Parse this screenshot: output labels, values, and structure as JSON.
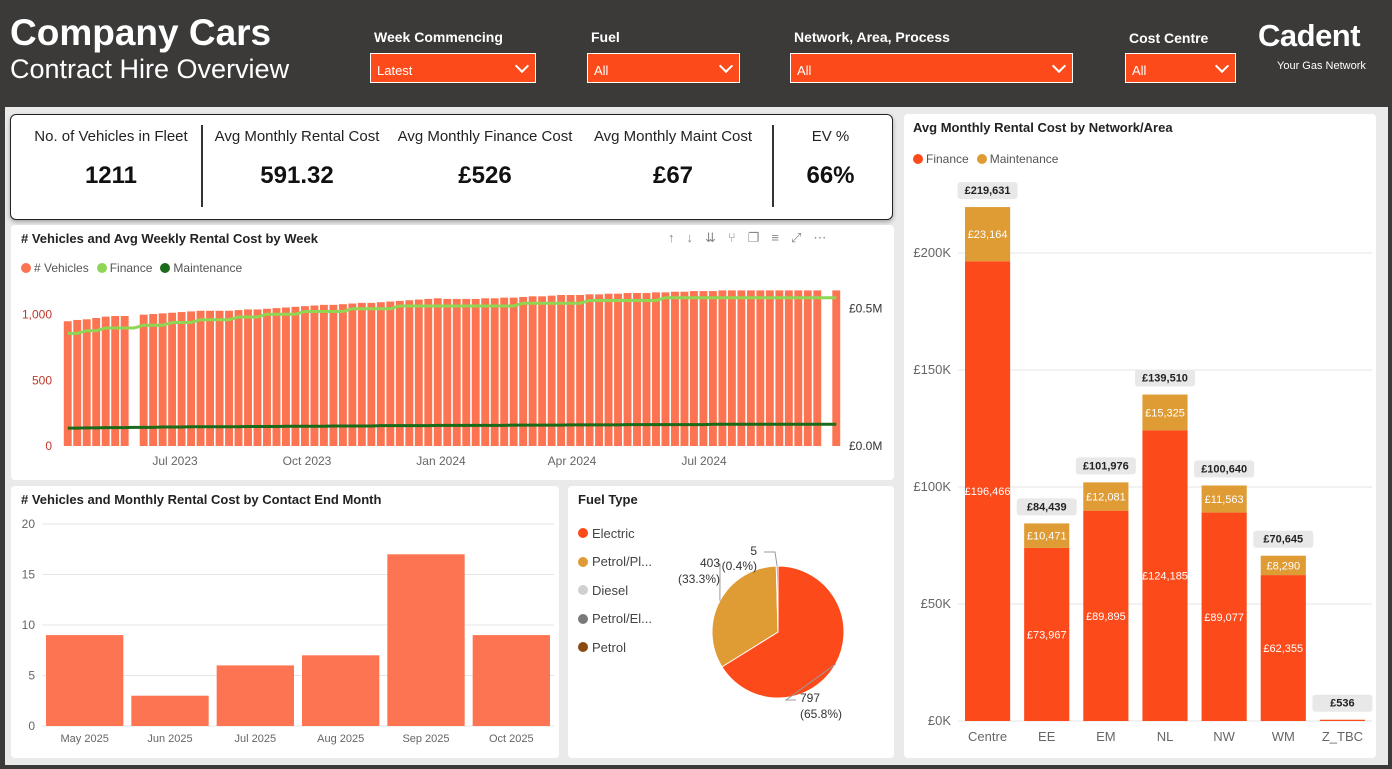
{
  "header": {
    "title": "Company Cars",
    "subtitle": "Contract Hire Overview",
    "filters": [
      {
        "label": "Week Commencing",
        "value": "Latest"
      },
      {
        "label": "Fuel",
        "value": "All"
      },
      {
        "label": "Network, Area, Process",
        "value": "All"
      },
      {
        "label": "Cost Centre",
        "value": "All"
      }
    ],
    "logo": "Cadent",
    "logo_tagline": "Your Gas Network"
  },
  "kpis": [
    {
      "label": "No. of Vehicles in Fleet",
      "value": "1211"
    },
    {
      "label": "Avg Monthly Rental Cost",
      "value": "591.32"
    },
    {
      "label": "Avg Monthly Finance Cost",
      "value": "£526"
    },
    {
      "label": "Avg Monthly Maint Cost",
      "value": "£67"
    },
    {
      "label": "EV %",
      "value": "66%"
    }
  ],
  "toolbar_icons": [
    "arrow-up-icon",
    "arrow-down-icon",
    "expand-all-icon",
    "drill-icon",
    "copy-icon",
    "filter-icon",
    "focus-icon",
    "more-icon"
  ],
  "colors": {
    "bar": "#fc7451",
    "finance": "#fc4a1a",
    "maintenance": "#df9b34",
    "green_light": "#8ed654",
    "green_dark": "#1a6b1a",
    "header": "#3b3a39"
  },
  "chart_data": [
    {
      "type": "bar",
      "title": "# Vehicles and Avg Weekly Rental Cost by Week",
      "legend": [
        "# Vehicles",
        "Finance",
        "Maintenance"
      ],
      "legend_position": "top-left",
      "x_ticks": [
        "Jul 2023",
        "Oct 2023",
        "Jan 2024",
        "Apr 2024",
        "Jul 2024"
      ],
      "y_ticks_left": [
        "0",
        "500",
        "1,000"
      ],
      "y_ticks_right": [
        "£0.0M",
        "£0.5M"
      ],
      "ylim_left": [
        0,
        1150
      ],
      "ylim_right": [
        0,
        0.55
      ],
      "series": [
        {
          "name": "# Vehicles",
          "values": [
            950,
            960,
            965,
            975,
            985,
            990,
            990,
            0,
            1000,
            1005,
            1010,
            1015,
            1020,
            1025,
            1030,
            1030,
            1030,
            1030,
            1035,
            1040,
            1040,
            1045,
            1050,
            1055,
            1060,
            1065,
            1070,
            1075,
            1075,
            1080,
            1085,
            1090,
            1090,
            1095,
            1100,
            1105,
            1110,
            1115,
            1120,
            1125,
            1120,
            1120,
            1120,
            1120,
            1125,
            1125,
            1130,
            1130,
            1135,
            1140,
            1140,
            1145,
            1150,
            1150,
            1150,
            1155,
            1155,
            1160,
            1160,
            1165,
            1165,
            1165,
            1170,
            1170,
            1175,
            1175,
            1180,
            1180,
            1180,
            1185,
            1185,
            1185,
            1185,
            1185,
            1185,
            1185,
            1185,
            1185,
            1185,
            1185,
            0,
            1185
          ]
        },
        {
          "name": "Finance",
          "values": [
            0.41,
            0.41,
            0.42,
            0.42,
            0.43,
            0.43,
            0.43,
            0.43,
            0.44,
            0.44,
            0.44,
            0.45,
            0.45,
            0.45,
            0.46,
            0.46,
            0.46,
            0.46,
            0.47,
            0.47,
            0.47,
            0.48,
            0.48,
            0.48,
            0.48,
            0.49,
            0.49,
            0.49,
            0.49,
            0.49,
            0.5,
            0.5,
            0.5,
            0.5,
            0.5,
            0.51,
            0.51,
            0.51,
            0.51,
            0.51,
            0.51,
            0.51,
            0.51,
            0.51,
            0.51,
            0.51,
            0.51,
            0.51,
            0.52,
            0.52,
            0.52,
            0.52,
            0.52,
            0.52,
            0.52,
            0.53,
            0.53,
            0.53,
            0.53,
            0.53,
            0.53,
            0.53,
            0.53,
            0.54,
            0.54,
            0.54,
            0.54,
            0.54,
            0.54,
            0.54,
            0.54,
            0.54,
            0.54,
            0.54,
            0.54,
            0.54,
            0.54,
            0.54,
            0.54,
            0.54,
            0.54,
            0.54
          ]
        },
        {
          "name": "Maintenance",
          "values": [
            0.065,
            0.065,
            0.066,
            0.066,
            0.067,
            0.067,
            0.067,
            0.068,
            0.068,
            0.068,
            0.069,
            0.069,
            0.069,
            0.07,
            0.07,
            0.07,
            0.07,
            0.07,
            0.07,
            0.071,
            0.071,
            0.071,
            0.071,
            0.072,
            0.072,
            0.072,
            0.072,
            0.072,
            0.073,
            0.073,
            0.073,
            0.073,
            0.073,
            0.074,
            0.074,
            0.074,
            0.074,
            0.074,
            0.074,
            0.075,
            0.075,
            0.075,
            0.075,
            0.075,
            0.075,
            0.075,
            0.075,
            0.076,
            0.076,
            0.076,
            0.076,
            0.076,
            0.076,
            0.077,
            0.077,
            0.077,
            0.077,
            0.077,
            0.077,
            0.078,
            0.078,
            0.078,
            0.078,
            0.078,
            0.078,
            0.078,
            0.078,
            0.078,
            0.079,
            0.079,
            0.079,
            0.079,
            0.079,
            0.079,
            0.079,
            0.079,
            0.079,
            0.079,
            0.079,
            0.079,
            0.079,
            0.079
          ]
        }
      ]
    },
    {
      "type": "bar",
      "title": "# Vehicles and Monthly Rental Cost by Contact End Month",
      "categories": [
        "May 2025",
        "Jun 2025",
        "Jul 2025",
        "Aug 2025",
        "Sep 2025",
        "Oct 2025"
      ],
      "values": [
        9,
        3,
        6,
        7,
        17,
        9
      ],
      "y_ticks": [
        "0",
        "5",
        "10",
        "15",
        "20"
      ],
      "ylim": [
        0,
        20
      ]
    },
    {
      "type": "pie",
      "title": "Fuel Type",
      "legend": [
        "Electric",
        "Petrol/Pl...",
        "Diesel",
        "Petrol/El...",
        "Petrol"
      ],
      "legend_colors": [
        "#fc4a1a",
        "#df9b34",
        "#d0d0d0",
        "#7a7a7a",
        "#8a4a10"
      ],
      "slices": [
        {
          "name": "Electric",
          "value": 797,
          "label_value": "797",
          "label_pct": "(65.8%)"
        },
        {
          "name": "Petrol/Pl...",
          "value": 403,
          "label_value": "403",
          "label_pct": "(33.3%)"
        },
        {
          "name": "Petrol/El...",
          "value": 5,
          "label_value": "5",
          "label_pct": "(0.4%)"
        }
      ]
    },
    {
      "type": "bar",
      "title": "Avg Monthly Rental Cost by Network/Area",
      "legend": [
        "Finance",
        "Maintenance"
      ],
      "legend_position": "top-left",
      "categories": [
        "Centre",
        "EE",
        "EM",
        "NL",
        "NW",
        "WM",
        "Z_TBC"
      ],
      "series": [
        {
          "name": "Finance",
          "values": [
            196466,
            73967,
            89895,
            124185,
            89077,
            62355,
            536
          ],
          "labels": [
            "£196,466",
            "£73,967",
            "£89,895",
            "£124,185",
            "£89,077",
            "£62,355",
            ""
          ]
        },
        {
          "name": "Maintenance",
          "values": [
            23164,
            10471,
            12081,
            15325,
            11563,
            8290,
            0
          ],
          "labels": [
            "£23,164",
            "£10,471",
            "£12,081",
            "£15,325",
            "£11,563",
            "£8,290",
            ""
          ]
        }
      ],
      "totals": [
        "£219,631",
        "£84,439",
        "£101,976",
        "£139,510",
        "£100,640",
        "£70,645",
        "£536"
      ],
      "y_ticks": [
        "£0K",
        "£50K",
        "£100K",
        "£150K",
        "£200K"
      ],
      "ylim": [
        0,
        250000
      ]
    }
  ]
}
